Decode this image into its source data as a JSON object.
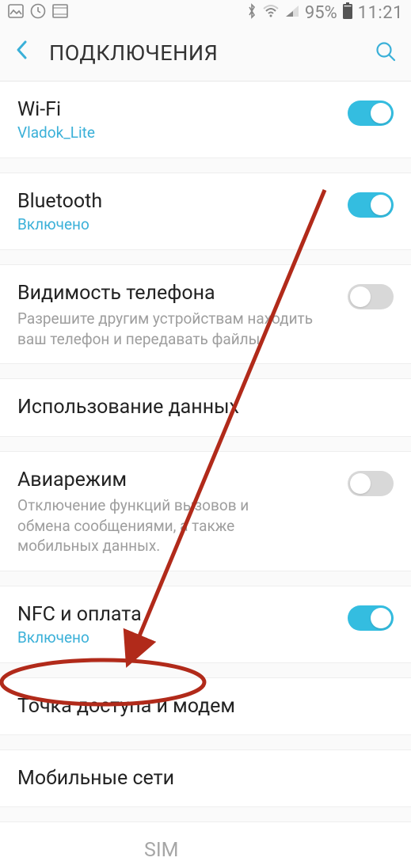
{
  "status_bar": {
    "battery_pct": "95%",
    "time": "11:21"
  },
  "header": {
    "title": "ПОДКЛЮЧЕНИЯ"
  },
  "rows": {
    "wifi": {
      "title": "Wi-Fi",
      "sub": "Vladok_Lite",
      "on": true
    },
    "bluetooth": {
      "title": "Bluetooth",
      "sub": "Включено",
      "on": true
    },
    "visibility": {
      "title": "Видимость телефона",
      "desc": "Разрешите другим устройствам находить ваш телефон и передавать файлы.",
      "on": false
    },
    "data_usage": {
      "title": "Использование данных"
    },
    "airplane": {
      "title": "Авиарежим",
      "desc": "Отключение функций вызовов и обмена сообщениями, а также мобильных данных.",
      "on": false
    },
    "nfc": {
      "title": "NFC и оплата",
      "sub": "Включено",
      "on": true
    },
    "hotspot": {
      "title": "Точка доступа и модем"
    },
    "mobile_networks": {
      "title": "Мобильные сети"
    },
    "sim": {
      "title_partial": "SIM"
    }
  },
  "colors": {
    "accent": "#3ab0d8",
    "annotation": "#b12a1a"
  }
}
